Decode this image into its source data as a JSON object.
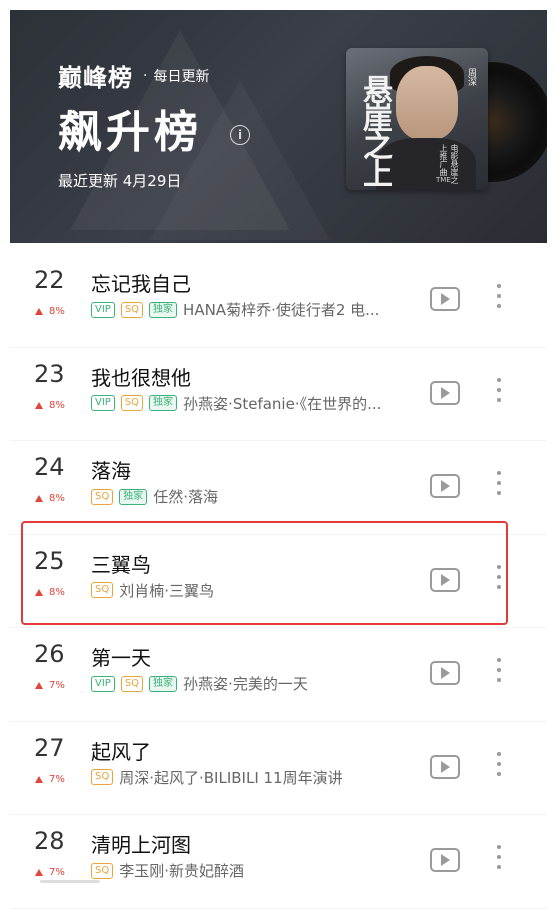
{
  "header": {
    "brand": "巅峰榜",
    "separator": "·",
    "subtitle": "每日更新",
    "chart_title": "飙升榜",
    "update_text": "最近更新 4月29日",
    "cover": {
      "calligraphy": "悬崖之上",
      "artist_small": "周深",
      "album_small": "电影悬崖之上推广曲"
    }
  },
  "songs": [
    {
      "rank": "22",
      "trend": "8%",
      "title": "忘记我自己",
      "tags": [
        "VIP",
        "SQ",
        "独家"
      ],
      "artist": "HANA菊梓乔·使徒行者2 电..."
    },
    {
      "rank": "23",
      "trend": "8%",
      "title": "我也很想他",
      "tags": [
        "VIP",
        "SQ",
        "独家"
      ],
      "artist": "孙燕姿·Stefanie·《在世界的..."
    },
    {
      "rank": "24",
      "trend": "8%",
      "title": "落海",
      "tags": [
        "SQ",
        "独家"
      ],
      "artist": "任然·落海"
    },
    {
      "rank": "25",
      "trend": "8%",
      "title": "三翼鸟",
      "tags": [
        "SQ"
      ],
      "artist": "刘肖楠·三翼鸟"
    },
    {
      "rank": "26",
      "trend": "7%",
      "title": "第一天",
      "tags": [
        "VIP",
        "SQ",
        "独家"
      ],
      "artist": "孙燕姿·完美的一天"
    },
    {
      "rank": "27",
      "trend": "7%",
      "title": "起风了",
      "tags": [
        "SQ"
      ],
      "artist": "周深·起风了·BILIBILI 11周年演讲"
    },
    {
      "rank": "28",
      "trend": "7%",
      "title": "清明上河图",
      "tags": [
        "SQ"
      ],
      "artist": "李玉刚·新贵妃醉酒"
    }
  ],
  "colors": {
    "trend_up": "#e0443a",
    "tag_vip": "#3ab27a",
    "tag_sq": "#e8a53a",
    "highlight": "#e53a3a"
  }
}
